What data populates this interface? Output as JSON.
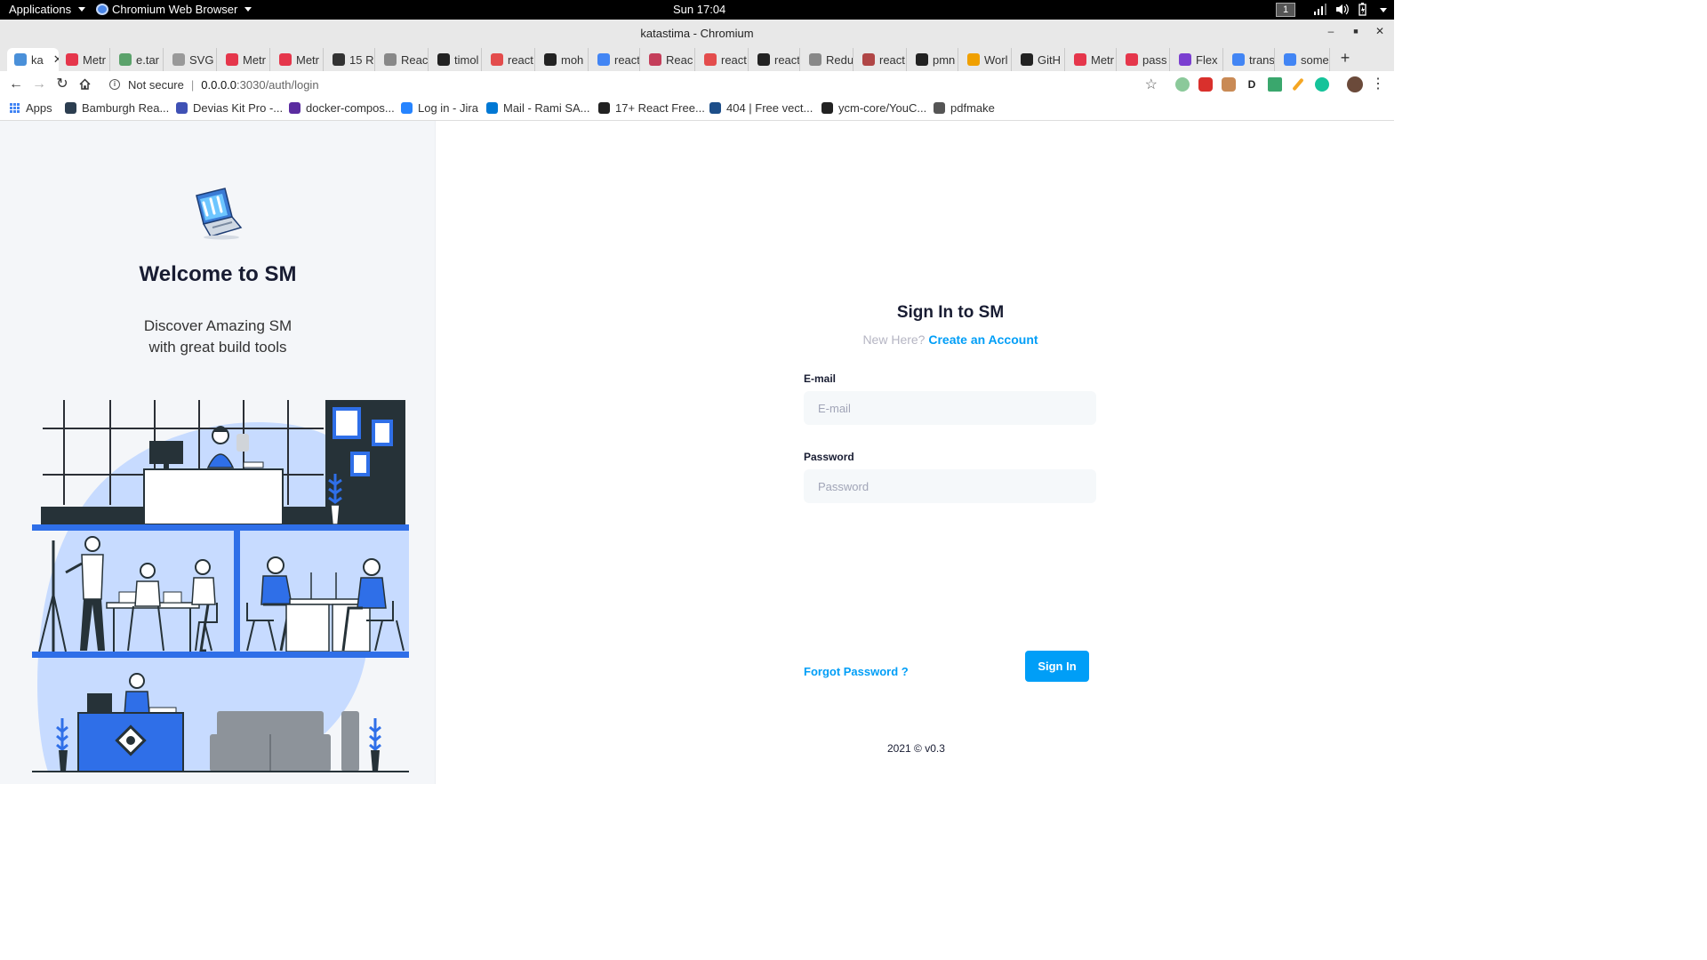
{
  "system_bar": {
    "applications": "Applications",
    "browser_menu": "Chromium Web Browser",
    "clock": "Sun 17:04",
    "workspace": "1"
  },
  "window": {
    "title": "katastima - Chromium"
  },
  "tabs": [
    {
      "label": "ka",
      "favicon_color": "#4a90d9"
    },
    {
      "label": "Metr",
      "favicon_color": "#e5364b"
    },
    {
      "label": "e.tar",
      "favicon_color": "#5ba26b"
    },
    {
      "label": "SVG",
      "favicon_color": "#999999"
    },
    {
      "label": "Metr",
      "favicon_color": "#e5364b"
    },
    {
      "label": "Metr",
      "favicon_color": "#e5364b"
    },
    {
      "label": "15 R",
      "favicon_color": "#333333"
    },
    {
      "label": "Reac",
      "favicon_color": "#888888"
    },
    {
      "label": "timol",
      "favicon_color": "#222222"
    },
    {
      "label": "react",
      "favicon_color": "#e34c4c"
    },
    {
      "label": "moh",
      "favicon_color": "#222222"
    },
    {
      "label": "react",
      "favicon_color": "#4285f4"
    },
    {
      "label": "Reac",
      "favicon_color": "#c43e5a"
    },
    {
      "label": "react",
      "favicon_color": "#e34c4c"
    },
    {
      "label": "react",
      "favicon_color": "#222222"
    },
    {
      "label": "Redu",
      "favicon_color": "#888888"
    },
    {
      "label": "react",
      "favicon_color": "#b04646"
    },
    {
      "label": "pmn",
      "favicon_color": "#222222"
    },
    {
      "label": "Worl",
      "favicon_color": "#f0a000"
    },
    {
      "label": "GitH",
      "favicon_color": "#222222"
    },
    {
      "label": "Metr",
      "favicon_color": "#e5364b"
    },
    {
      "label": "pass",
      "favicon_color": "#e5364b"
    },
    {
      "label": "Flex",
      "favicon_color": "#7a3fd0"
    },
    {
      "label": "trans",
      "favicon_color": "#4285f4"
    },
    {
      "label": "some",
      "favicon_color": "#4285f4"
    }
  ],
  "toolbar": {
    "security_label": "Not secure",
    "url_host": "0.0.0.0",
    "url_path": ":3030/auth/login"
  },
  "bookmarks": [
    {
      "label": "Apps",
      "color": "#4285f4"
    },
    {
      "label": "Bamburgh Rea...",
      "color": "#2c3e50"
    },
    {
      "label": "Devias Kit Pro -...",
      "color": "#3f51b5"
    },
    {
      "label": "docker-compos...",
      "color": "#5b2ca0"
    },
    {
      "label": "Log in - Jira",
      "color": "#2684ff"
    },
    {
      "label": "Mail - Rami SA...",
      "color": "#0078d4"
    },
    {
      "label": "17+ React Free...",
      "color": "#222222"
    },
    {
      "label": "404 | Free vect...",
      "color": "#1d4e89"
    },
    {
      "label": "ycm-core/YouC...",
      "color": "#222222"
    },
    {
      "label": "pdfmake",
      "color": "#555555"
    }
  ],
  "aside": {
    "heading": "Welcome to SM",
    "subtitle_line1": "Discover Amazing SM",
    "subtitle_line2": "with great build tools"
  },
  "signin": {
    "title": "Sign In to SM",
    "new_here": "New Here?",
    "create_account": "Create an Account",
    "email_label": "E-mail",
    "email_placeholder": "E-mail",
    "password_label": "Password",
    "password_placeholder": "Password",
    "forgot_password": "Forgot Password ?",
    "submit": "Sign In"
  },
  "footer": {
    "text": "2021 © v0.3"
  },
  "colors": {
    "primary": "#009ef7",
    "heading": "#181c32",
    "aside_bg": "#f4f6f9",
    "illustration_blue": "#2f6fe8"
  }
}
